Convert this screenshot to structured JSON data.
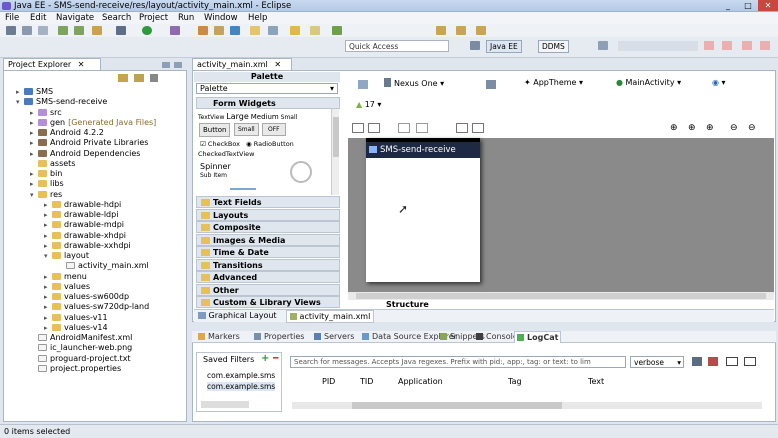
{
  "window": {
    "title": "Java EE - SMS-send-receive/res/layout/activity_main.xml - Eclipse",
    "controls": [
      "_",
      "□",
      "✕"
    ]
  },
  "menu": [
    "File",
    "Edit",
    "Navigate",
    "Search",
    "Project",
    "Run",
    "Window",
    "Help"
  ],
  "quick_access": {
    "placeholder": "Quick Access"
  },
  "perspectives": {
    "java_ee": "Java EE",
    "ddms": "DDMS"
  },
  "explorer": {
    "title": "Project Explorer",
    "tree": [
      {
        "label": "SMS",
        "depth": 0,
        "icon": "project-icon",
        "arrow": "▸"
      },
      {
        "label": "SMS-send-receive",
        "depth": 0,
        "icon": "project-icon",
        "arrow": "▾"
      },
      {
        "label": "src",
        "depth": 1,
        "icon": "package-folder-icon",
        "arrow": "▸"
      },
      {
        "label": "gen",
        "suffix": "[Generated Java Files]",
        "depth": 1,
        "icon": "package-folder-icon",
        "arrow": "▸"
      },
      {
        "label": "Android 4.2.2",
        "depth": 1,
        "icon": "library-icon",
        "arrow": "▸"
      },
      {
        "label": "Android Private Libraries",
        "depth": 1,
        "icon": "library-icon",
        "arrow": "▸"
      },
      {
        "label": "Android Dependencies",
        "depth": 1,
        "icon": "library-icon",
        "arrow": "▸"
      },
      {
        "label": "assets",
        "depth": 1,
        "icon": "folder-icon",
        "arrow": ""
      },
      {
        "label": "bin",
        "depth": 1,
        "icon": "folder-icon",
        "arrow": "▸"
      },
      {
        "label": "libs",
        "depth": 1,
        "icon": "folder-icon",
        "arrow": "▸"
      },
      {
        "label": "res",
        "depth": 1,
        "icon": "folder-icon",
        "arrow": "▾"
      },
      {
        "label": "drawable-hdpi",
        "depth": 2,
        "icon": "folder-icon",
        "arrow": "▸"
      },
      {
        "label": "drawable-ldpi",
        "depth": 2,
        "icon": "folder-icon",
        "arrow": "▸"
      },
      {
        "label": "drawable-mdpi",
        "depth": 2,
        "icon": "folder-icon",
        "arrow": "▸"
      },
      {
        "label": "drawable-xhdpi",
        "depth": 2,
        "icon": "folder-icon",
        "arrow": "▸"
      },
      {
        "label": "drawable-xxhdpi",
        "depth": 2,
        "icon": "folder-icon",
        "arrow": "▸"
      },
      {
        "label": "layout",
        "depth": 2,
        "icon": "folder-icon",
        "arrow": "▾"
      },
      {
        "label": "activity_main.xml",
        "depth": 3,
        "icon": "xml-file-icon",
        "arrow": ""
      },
      {
        "label": "menu",
        "depth": 2,
        "icon": "folder-icon",
        "arrow": "▸"
      },
      {
        "label": "values",
        "depth": 2,
        "icon": "folder-icon",
        "arrow": "▸"
      },
      {
        "label": "values-sw600dp",
        "depth": 2,
        "icon": "folder-icon",
        "arrow": "▸"
      },
      {
        "label": "values-sw720dp-land",
        "depth": 2,
        "icon": "folder-icon",
        "arrow": "▸"
      },
      {
        "label": "values-v11",
        "depth": 2,
        "icon": "folder-icon",
        "arrow": "▸"
      },
      {
        "label": "values-v14",
        "depth": 2,
        "icon": "folder-icon",
        "arrow": "▸"
      },
      {
        "label": "AndroidManifest.xml",
        "depth": 1,
        "icon": "xml-file-icon",
        "arrow": ""
      },
      {
        "label": "ic_launcher-web.png",
        "depth": 1,
        "icon": "image-file-icon",
        "arrow": ""
      },
      {
        "label": "proguard-project.txt",
        "depth": 1,
        "icon": "text-file-icon",
        "arrow": ""
      },
      {
        "label": "project.properties",
        "depth": 1,
        "icon": "text-file-icon",
        "arrow": ""
      }
    ]
  },
  "editor": {
    "tab": "activity_main.xml",
    "palette_label": "Palette",
    "palette_select": "Palette",
    "bottom_tabs": [
      "Graphical Layout",
      "activity_main.xml"
    ],
    "structure": "Structure"
  },
  "palette": {
    "form_widgets": "Form Widgets",
    "preview": {
      "textview": "TextView",
      "large": "Large",
      "medium": "Medium",
      "small": "Small",
      "button": "Button",
      "small_button": "Small",
      "toggle": "OFF",
      "checkbox": "CheckBox",
      "radio": "RadioButton",
      "checked_textview": "CheckedTextView",
      "spinner": "Spinner",
      "sub_item": "Sub Item"
    },
    "categories": [
      "Text Fields",
      "Layouts",
      "Composite",
      "Images & Media",
      "Time & Date",
      "Transitions",
      "Advanced",
      "Other",
      "Custom & Library Views"
    ]
  },
  "layout_toolbar": {
    "device": "Nexus One",
    "theme": "AppTheme",
    "activity": "MainActivity",
    "api": "17"
  },
  "phone": {
    "app_title": "SMS-send-receive"
  },
  "bottom_panel": {
    "tabs": [
      "Markers",
      "Properties",
      "Servers",
      "Data Source Explorer",
      "Snippets",
      "Console",
      "LogCat"
    ],
    "saved_filters": "Saved Filters",
    "filters": [
      "com.example.sms",
      "com.example.sms"
    ],
    "search_placeholder": "Search for messages. Accepts Java regexes. Prefix with pid:, app:, tag: or text: to lim",
    "level": "verbose",
    "columns": [
      "PID",
      "TID",
      "Application",
      "Tag",
      "Text"
    ]
  },
  "status": {
    "text": "0 items selected"
  },
  "colors": {
    "title_gradient": "#c9daf0",
    "phone_bar": "#1e2a44",
    "canvas": "#8a8a8a"
  }
}
